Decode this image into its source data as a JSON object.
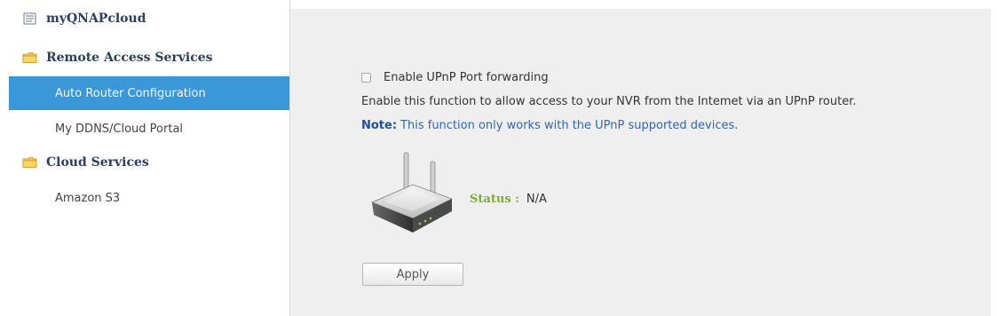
{
  "sidebar": {
    "items": [
      {
        "label": "myQNAPcloud",
        "type": "group",
        "icon": "page-icon"
      },
      {
        "label": "Remote Access Services",
        "type": "group",
        "icon": "folder-icon"
      },
      {
        "label": "Auto Router Configuration",
        "type": "child",
        "selected": true
      },
      {
        "label": "My DDNS/Cloud Portal",
        "type": "child"
      },
      {
        "label": "Cloud Services",
        "type": "group",
        "icon": "folder-icon"
      },
      {
        "label": "Amazon S3",
        "type": "child"
      }
    ]
  },
  "main": {
    "upnp_checkbox_label": "Enable UPnP Port forwarding",
    "upnp_checked": false,
    "description": "Enable this function to allow access to your NVR from the Intemet via an UPnP router.",
    "note_label": "Note:",
    "note_text": "This function only works with the UPnP supported devices.",
    "status_label": "Status :",
    "status_value": "N/A",
    "apply_label": "Apply",
    "router_icon": "wireless-router-icon"
  },
  "colors": {
    "selected_bg": "#3a98d8",
    "status_label": "#7fae2c",
    "note": "#2f67b3",
    "panel_bg": "#efefef"
  }
}
